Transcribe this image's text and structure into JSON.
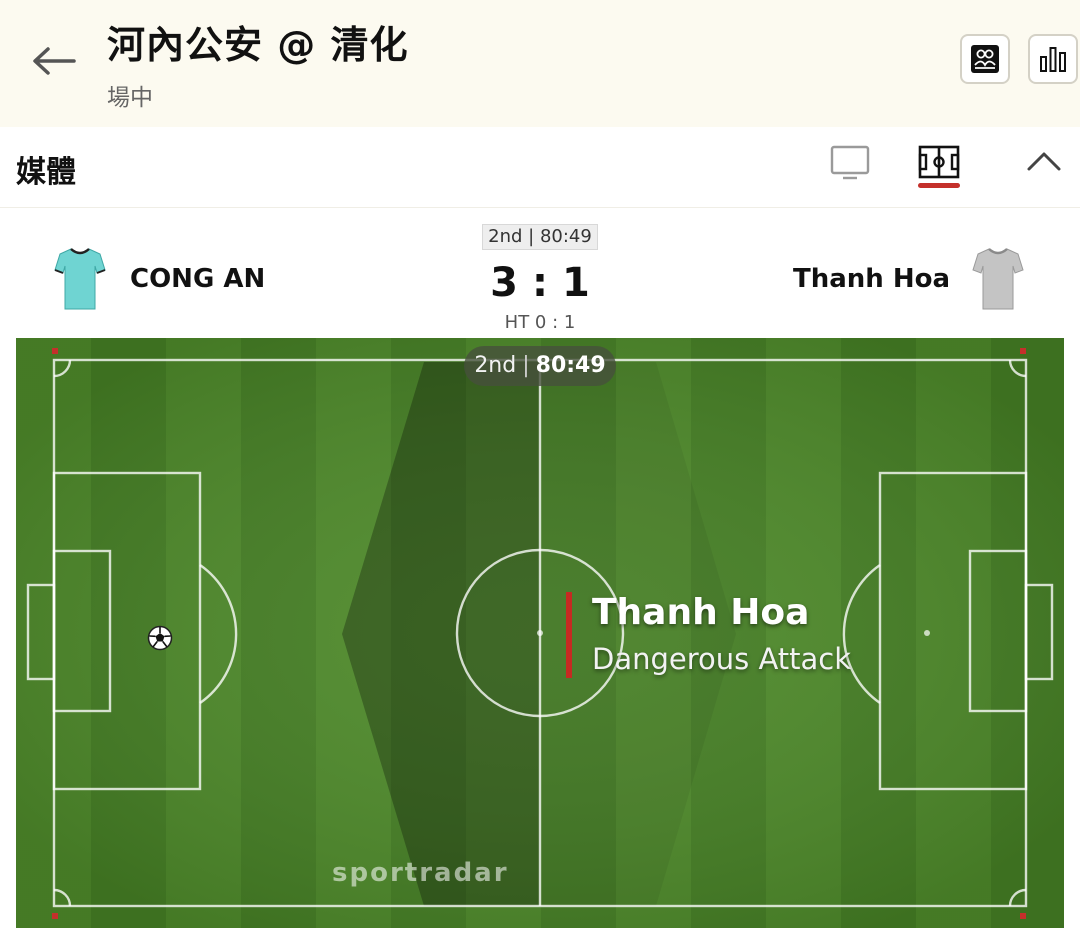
{
  "header": {
    "title": "河內公安 @ 清化",
    "status": "場中",
    "back_icon": "back-arrow-icon",
    "lineups_icon": "lineups-icon",
    "stats_icon": "bar-chart-icon"
  },
  "media": {
    "title": "媒體",
    "tabs": [
      {
        "icon": "tv-icon",
        "active": false
      },
      {
        "icon": "pitch-tracker-icon",
        "active": true
      }
    ],
    "collapse_icon": "chevron-up-icon",
    "active_color": "#c4302b"
  },
  "match": {
    "period_clock": "2nd | 80:49",
    "home": {
      "name": "CONG AN",
      "score": "3",
      "shirt_color": "#6fd4d2"
    },
    "away": {
      "name": "Thanh Hoa",
      "score": "1",
      "shirt_color": "#bdbdbd"
    },
    "separator": ":",
    "halftime": "HT 0 : 1"
  },
  "tracker": {
    "period": "2nd",
    "divider": "|",
    "clock": "80:49",
    "event_team": "Thanh Hoa",
    "event_text": "Dangerous Attack",
    "brand": "sportradar",
    "pitch_color": "#4e8a2a",
    "event_color": "#c62a22"
  }
}
